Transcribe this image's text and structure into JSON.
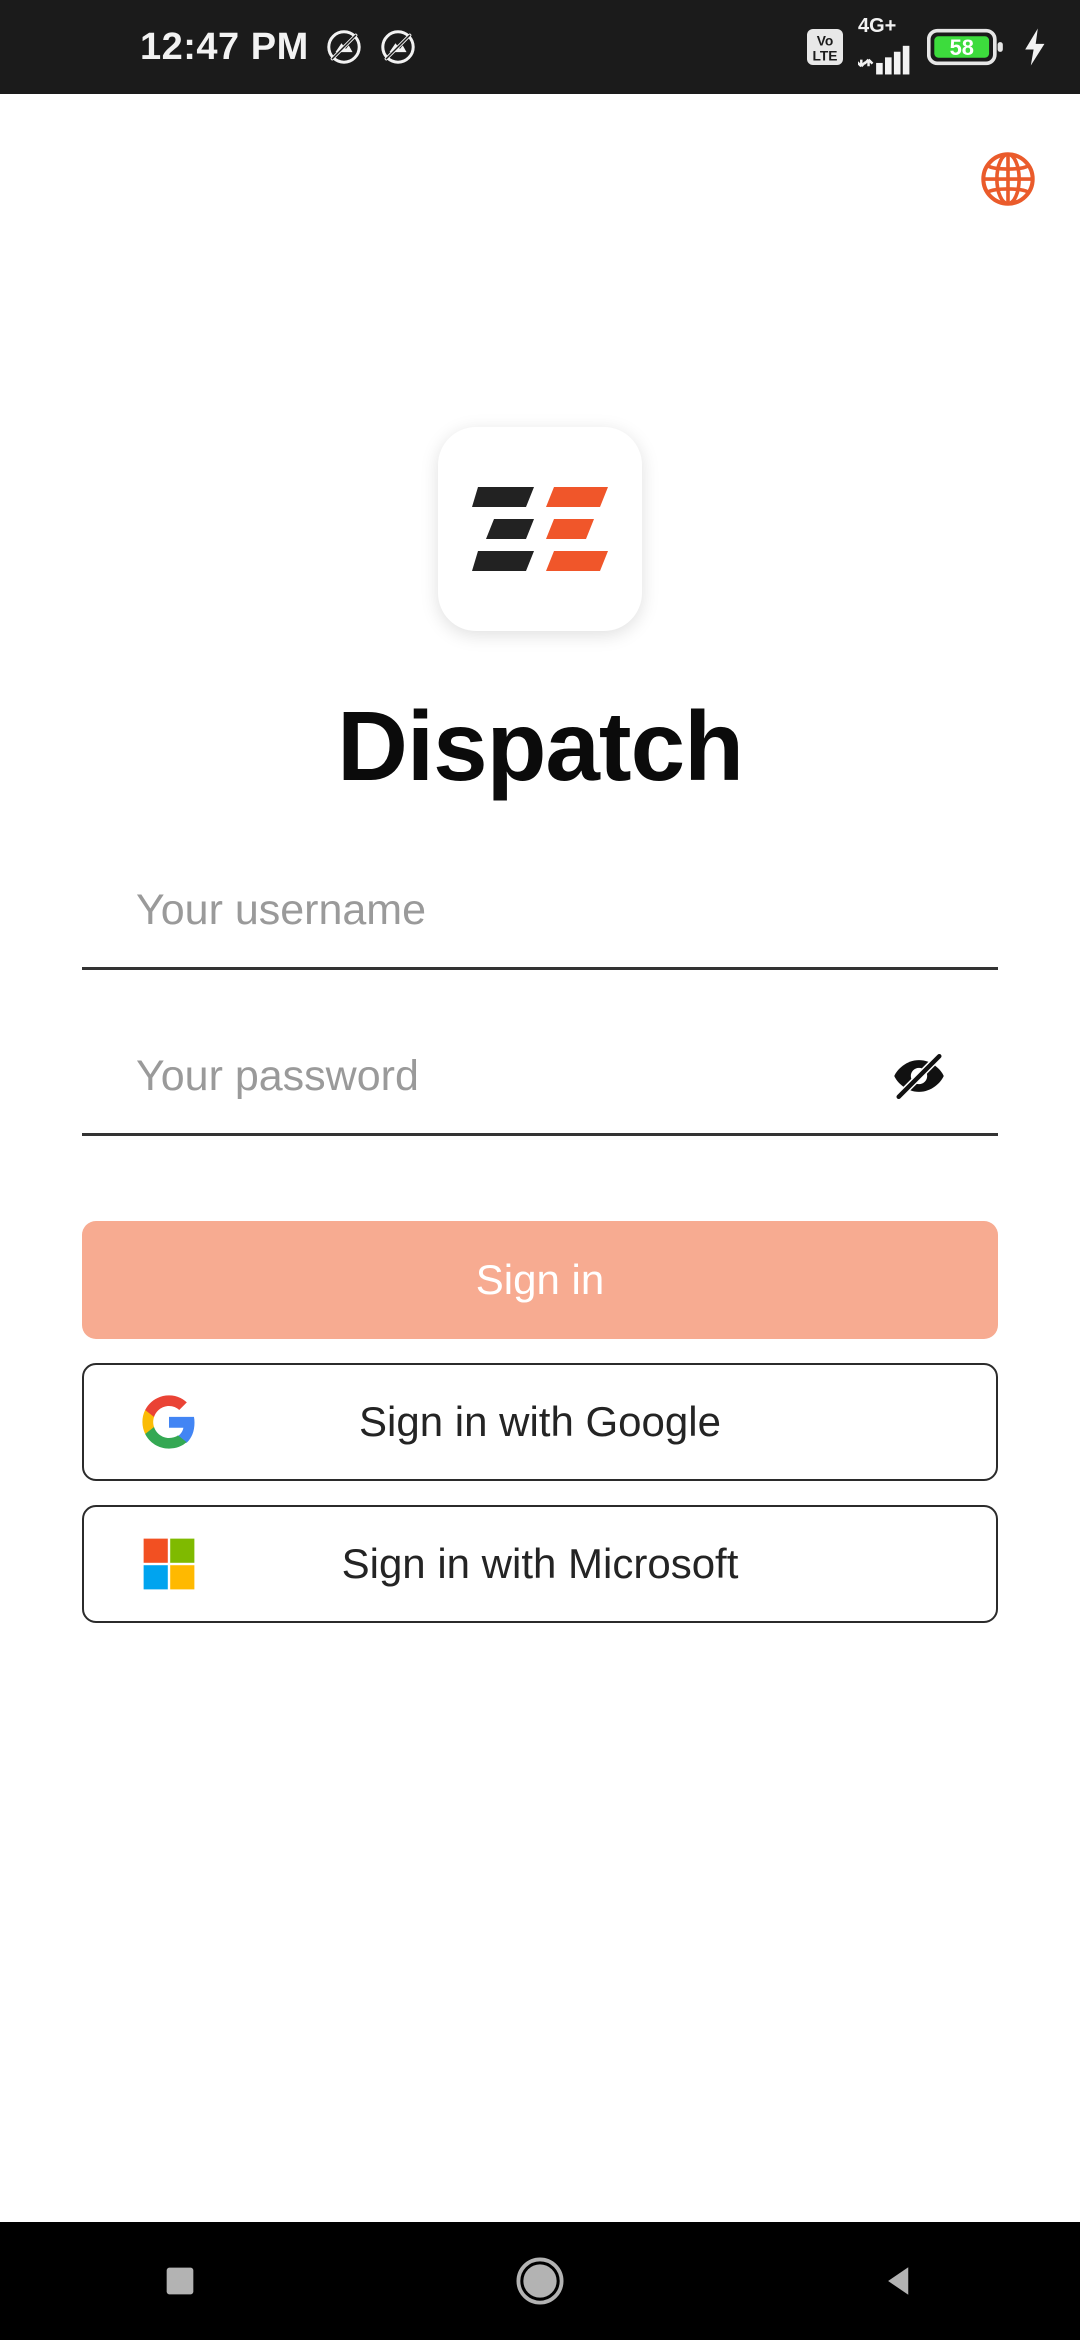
{
  "status_bar": {
    "clock": "12:47 PM",
    "network_label": "4G+",
    "volte_label_top": "Vo",
    "volte_label_bottom": "LTE",
    "battery_percent": "58",
    "battery_color": "#3ddc3d",
    "charging": true,
    "icons": [
      "dnd-icon",
      "dnd-icon",
      "volte-icon",
      "signal-icon",
      "battery-icon",
      "charging-bolt-icon"
    ],
    "background": "#1b1b1b",
    "foreground": "#f2f2f2"
  },
  "header": {
    "language_icon": "globe-icon",
    "language_icon_color": "#ea5b2b"
  },
  "branding": {
    "logo_icon": "dispatch-logo-icon",
    "logo_dark_color": "#222222",
    "logo_accent_color": "#f0562a",
    "app_title": "Dispatch"
  },
  "form": {
    "username": {
      "placeholder": "Your username",
      "value": ""
    },
    "password": {
      "placeholder": "Your password",
      "value": "",
      "toggle_icon": "eye-off-icon"
    }
  },
  "actions": {
    "sign_in": {
      "label": "Sign in",
      "background": "#f7ab91",
      "text_color": "#ffffff"
    },
    "google": {
      "label": "Sign in with Google",
      "icon": "google-g-icon"
    },
    "microsoft": {
      "label": "Sign in with Microsoft",
      "icon": "microsoft-squares-icon"
    }
  },
  "nav_bar": {
    "recents_label": "Recents",
    "home_label": "Home",
    "back_label": "Back",
    "background": "#000000",
    "glyph_color": "#b3b3b3"
  }
}
